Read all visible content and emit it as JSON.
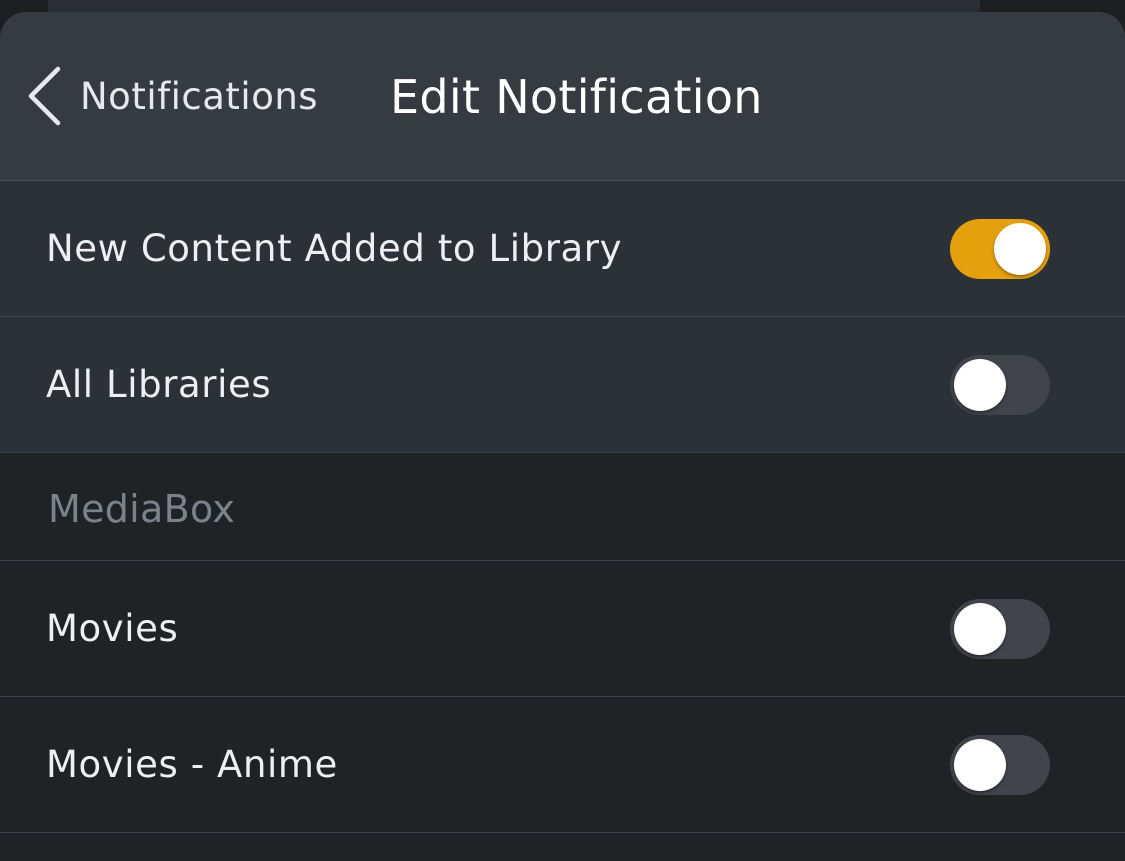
{
  "navbar": {
    "back_label": "Notifications",
    "title": "Edit Notification"
  },
  "settings": [
    {
      "label": "New Content Added to Library",
      "on": true
    },
    {
      "label": "All Libraries",
      "on": false
    }
  ],
  "server_section": {
    "header": "MediaBox",
    "libraries": [
      {
        "label": "Movies",
        "on": false
      },
      {
        "label": "Movies - Anime",
        "on": false
      }
    ]
  },
  "colors": {
    "accent": "#e5a00d",
    "toggle_off": "#41444b",
    "navbar_bg": "#363a41",
    "group_bg": "#2c3037",
    "list_bg": "#202326"
  }
}
